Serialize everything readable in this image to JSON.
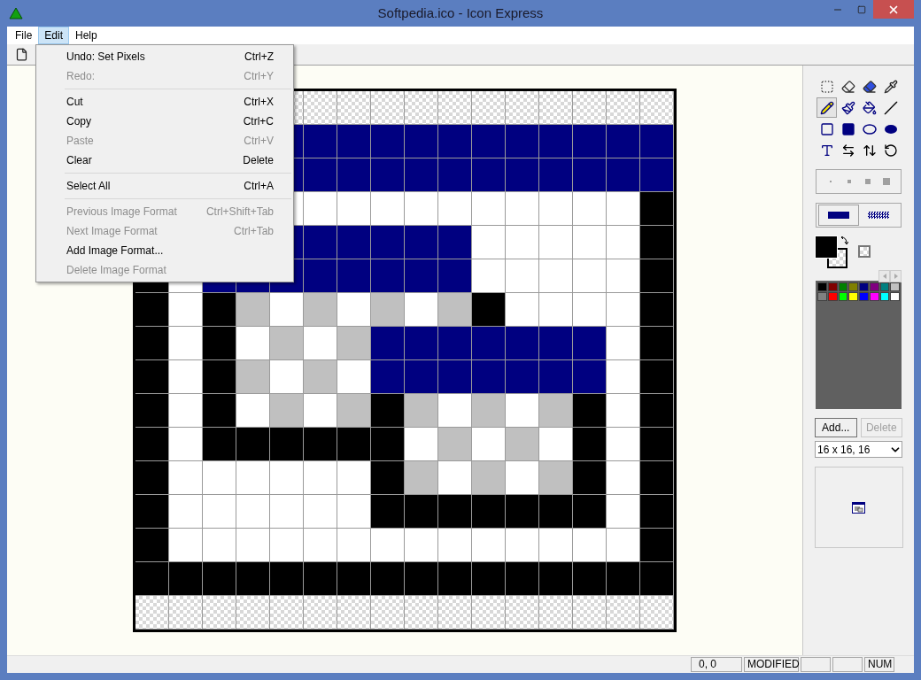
{
  "window": {
    "title": "Softpedia.ico - Icon Express"
  },
  "menu_bar": [
    {
      "label": "File",
      "selected": false
    },
    {
      "label": "Edit",
      "selected": true
    },
    {
      "label": "Help",
      "selected": false
    }
  ],
  "edit_menu": [
    {
      "kind": "item",
      "label": "Undo: Set Pixels",
      "shortcut": "Ctrl+Z",
      "disabled": false
    },
    {
      "kind": "item",
      "label": "Redo:",
      "shortcut": "Ctrl+Y",
      "disabled": true
    },
    {
      "kind": "separator"
    },
    {
      "kind": "item",
      "label": "Cut",
      "shortcut": "Ctrl+X",
      "disabled": false
    },
    {
      "kind": "item",
      "label": "Copy",
      "shortcut": "Ctrl+C",
      "disabled": false
    },
    {
      "kind": "item",
      "label": "Paste",
      "shortcut": "Ctrl+V",
      "disabled": true
    },
    {
      "kind": "item",
      "label": "Clear",
      "shortcut": "Delete",
      "disabled": false
    },
    {
      "kind": "separator"
    },
    {
      "kind": "item",
      "label": "Select All",
      "shortcut": "Ctrl+A",
      "disabled": false
    },
    {
      "kind": "separator"
    },
    {
      "kind": "item",
      "label": "Previous Image Format",
      "shortcut": "Ctrl+Shift+Tab",
      "disabled": true
    },
    {
      "kind": "item",
      "label": "Next Image Format",
      "shortcut": "Ctrl+Tab",
      "disabled": true
    },
    {
      "kind": "item",
      "label": "Add Image Format...",
      "disabled": false
    },
    {
      "kind": "item",
      "label": "Delete Image Format",
      "disabled": true
    }
  ],
  "tools": [
    {
      "kind": "select",
      "selected": false
    },
    {
      "kind": "eraser",
      "selected": false
    },
    {
      "kind": "color-eraser",
      "selected": false
    },
    {
      "kind": "picker",
      "selected": false
    },
    {
      "kind": "pencil",
      "selected": true
    },
    {
      "kind": "brush",
      "selected": false
    },
    {
      "kind": "fill",
      "selected": false
    },
    {
      "kind": "line",
      "selected": false
    },
    {
      "kind": "rect",
      "selected": false
    },
    {
      "kind": "filled-rect",
      "selected": false
    },
    {
      "kind": "ellipse",
      "selected": false
    },
    {
      "kind": "filled-ellipse",
      "selected": false
    },
    {
      "kind": "text",
      "selected": false
    },
    {
      "kind": "flip-h",
      "selected": false
    },
    {
      "kind": "flip-v",
      "selected": false
    },
    {
      "kind": "rotate",
      "selected": false
    }
  ],
  "line_widths": [
    {
      "selected": false
    },
    {
      "selected": false
    },
    {
      "selected": false
    },
    {
      "selected": false
    }
  ],
  "fill_styles": [
    {
      "kind": "solid",
      "selected": true
    },
    {
      "kind": "dither",
      "selected": false
    }
  ],
  "foreground": {
    "color": "#000000"
  },
  "palette": [
    {
      "color": "#000000"
    },
    {
      "color": "#800000"
    },
    {
      "color": "#008000"
    },
    {
      "color": "#808000"
    },
    {
      "color": "#000080"
    },
    {
      "color": "#800080"
    },
    {
      "color": "#008080"
    },
    {
      "color": "#c0c0c0"
    },
    {
      "color": "#808080"
    },
    {
      "color": "#ff0000"
    },
    {
      "color": "#00ff00"
    },
    {
      "color": "#ffff00"
    },
    {
      "color": "#0000ff"
    },
    {
      "color": "#ff00ff"
    },
    {
      "color": "#00ffff"
    },
    {
      "color": "#ffffff"
    }
  ],
  "buttons": [
    {
      "label": "Add...",
      "disabled": false
    },
    {
      "label": "Delete",
      "disabled": true
    }
  ],
  "format_select": {
    "value": "16 x 16, 16"
  },
  "status_bar": [
    {
      "kind": "text",
      "text": "0, 0"
    },
    {
      "kind": "text",
      "text": "MODIFIED"
    },
    {
      "kind": "blank"
    },
    {
      "kind": "blank"
    },
    {
      "kind": "text",
      "text": "NUM"
    }
  ]
}
